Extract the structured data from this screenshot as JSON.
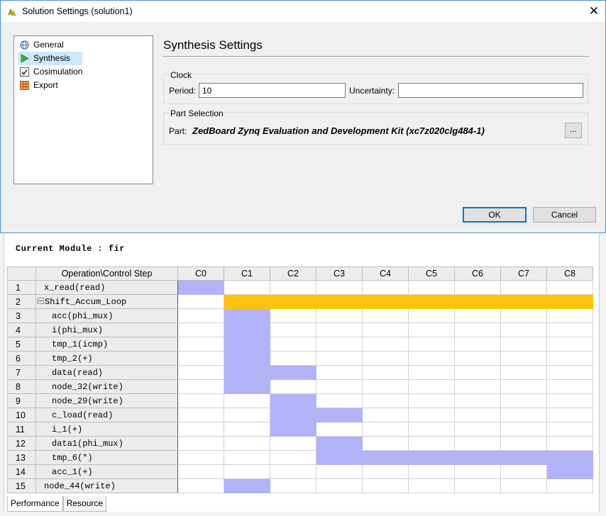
{
  "dialog": {
    "title": "Solution Settings (solution1)",
    "close_glyph": "✕",
    "nav": [
      {
        "label": "General",
        "icon": "globe-icon"
      },
      {
        "label": "Synthesis",
        "icon": "play-arrow-icon"
      },
      {
        "label": "Cosimulation",
        "icon": "checkbox-icon"
      },
      {
        "label": "Export",
        "icon": "grid-package-icon"
      }
    ],
    "settings_title": "Synthesis Settings",
    "clock": {
      "group_label": "Clock",
      "period_label": "Period:",
      "period_value": "10",
      "uncertainty_label": "Uncertainty:",
      "uncertainty_value": ""
    },
    "part": {
      "group_label": "Part Selection",
      "part_label": "Part:",
      "part_value": "ZedBoard Zynq Evaluation and Development Kit (xc7z020clg484-1)",
      "browse_label": "..."
    },
    "ok_label": "OK",
    "cancel_label": "Cancel",
    "accent_color": "#0078d7"
  },
  "perspective": {
    "module_label": "Current Module : fir",
    "table_header": "Operation\\Control Step",
    "steps": [
      "C0",
      "C1",
      "C2",
      "C3",
      "C4",
      "C5",
      "C6",
      "C7",
      "C8"
    ],
    "rows": [
      {
        "num": "1",
        "op": "x_read(read)",
        "indent": 0,
        "collapsible": false,
        "span": [
          0,
          0
        ],
        "loop": false
      },
      {
        "num": "2",
        "op": "Shift_Accum_Loop",
        "indent": 0,
        "collapsible": true,
        "span": [
          1,
          8
        ],
        "loop": true
      },
      {
        "num": "3",
        "op": "acc(phi_mux)",
        "indent": 2,
        "collapsible": false,
        "span": [
          1,
          1
        ],
        "loop": false
      },
      {
        "num": "4",
        "op": "i(phi_mux)",
        "indent": 2,
        "collapsible": false,
        "span": [
          1,
          1
        ],
        "loop": false
      },
      {
        "num": "5",
        "op": "tmp_1(icmp)",
        "indent": 2,
        "collapsible": false,
        "span": [
          1,
          1
        ],
        "loop": false
      },
      {
        "num": "6",
        "op": "tmp_2(+)",
        "indent": 2,
        "collapsible": false,
        "span": [
          1,
          1
        ],
        "loop": false
      },
      {
        "num": "7",
        "op": "data(read)",
        "indent": 2,
        "collapsible": false,
        "span": [
          1,
          2
        ],
        "loop": false
      },
      {
        "num": "8",
        "op": "node_32(write)",
        "indent": 2,
        "collapsible": false,
        "span": [
          1,
          1
        ],
        "loop": false
      },
      {
        "num": "9",
        "op": "node_29(write)",
        "indent": 2,
        "collapsible": false,
        "span": [
          2,
          2
        ],
        "loop": false
      },
      {
        "num": "10",
        "op": "c_load(read)",
        "indent": 2,
        "collapsible": false,
        "span": [
          2,
          3
        ],
        "loop": false
      },
      {
        "num": "11",
        "op": "i_1(+)",
        "indent": 2,
        "collapsible": false,
        "span": [
          2,
          2
        ],
        "loop": false
      },
      {
        "num": "12",
        "op": "data1(phi_mux)",
        "indent": 2,
        "collapsible": false,
        "span": [
          3,
          3
        ],
        "loop": false
      },
      {
        "num": "13",
        "op": "tmp_6(*)",
        "indent": 2,
        "collapsible": false,
        "span": [
          3,
          8
        ],
        "loop": false
      },
      {
        "num": "14",
        "op": "acc_1(+)",
        "indent": 2,
        "collapsible": false,
        "span": [
          8,
          8
        ],
        "loop": false
      },
      {
        "num": "15",
        "op": "node_44(write)",
        "indent": 1,
        "collapsible": false,
        "span": [
          1,
          1
        ],
        "loop": false
      }
    ],
    "tabs": [
      "Performance",
      "Resource"
    ],
    "op_color": "#b2b2f8",
    "loop_color": "#ffc20e"
  }
}
